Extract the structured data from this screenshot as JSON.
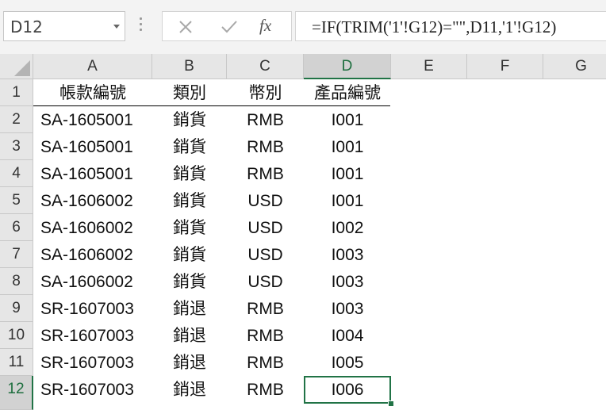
{
  "name_box": {
    "value": "D12"
  },
  "formula_bar": {
    "cancel_icon": "close-icon",
    "enter_icon": "check-icon",
    "fx_label": "fx",
    "formula": "=IF(TRIM('1'!G12)=\"\",D11,'1'!G12)"
  },
  "sheet": {
    "selected_cell": "D12",
    "columns": [
      "A",
      "B",
      "C",
      "D",
      "E",
      "F",
      "G"
    ],
    "rows": [
      "1",
      "2",
      "3",
      "4",
      "5",
      "6",
      "7",
      "8",
      "9",
      "10",
      "11",
      "12"
    ],
    "header": [
      "帳款編號",
      "類別",
      "幣別",
      "產品編號"
    ],
    "data": [
      [
        "SA-1605001",
        "銷貨",
        "RMB",
        "I001"
      ],
      [
        "SA-1605001",
        "銷貨",
        "RMB",
        "I001"
      ],
      [
        "SA-1605001",
        "銷貨",
        "RMB",
        "I001"
      ],
      [
        "SA-1606002",
        "銷貨",
        "USD",
        "I001"
      ],
      [
        "SA-1606002",
        "銷貨",
        "USD",
        "I002"
      ],
      [
        "SA-1606002",
        "銷貨",
        "USD",
        "I003"
      ],
      [
        "SA-1606002",
        "銷貨",
        "USD",
        "I003"
      ],
      [
        "SR-1607003",
        "銷退",
        "RMB",
        "I003"
      ],
      [
        "SR-1607003",
        "銷退",
        "RMB",
        "I004"
      ],
      [
        "SR-1607003",
        "銷退",
        "RMB",
        "I005"
      ],
      [
        "SR-1607003",
        "銷退",
        "RMB",
        "I006"
      ]
    ],
    "accent_color": "#217346"
  }
}
